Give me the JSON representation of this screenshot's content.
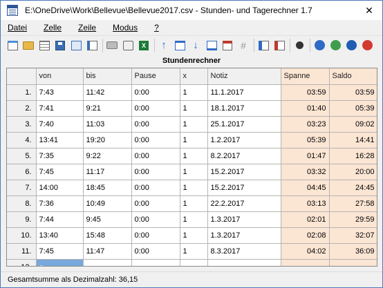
{
  "window": {
    "title": "E:\\OneDrive\\Work\\Bellevue\\Bellevue2017.csv - Stunden- und Tagerechner 1.7",
    "close_glyph": "✕"
  },
  "menu": [
    {
      "label": "Datei"
    },
    {
      "label": "Zelle"
    },
    {
      "label": "Zeile"
    },
    {
      "label": "Modus"
    },
    {
      "label": "?"
    }
  ],
  "toolbar": {
    "icons": [
      "new-icon",
      "open-folder-icon",
      "grid-icon",
      "save-icon",
      "edit-icon",
      "export-icon",
      "print-icon",
      "print-preview-icon",
      "excel-icon",
      "arrow-up-icon",
      "move-up-icon",
      "arrow-down-icon",
      "move-down-icon",
      "calendar-icon",
      "hash-icon",
      "insert-row-icon",
      "delete-row-icon",
      "settings-icon",
      "help-icon",
      "globe-icon",
      "info-icon",
      "exit-icon"
    ]
  },
  "section": {
    "title": "Stundenrechner"
  },
  "table": {
    "headers": [
      "",
      "von",
      "bis",
      "Pause",
      "x",
      "Notiz",
      "Spanne",
      "Saldo"
    ],
    "rows": [
      {
        "n": "1.",
        "von": "7:43",
        "bis": "11:42",
        "pause": "0:00",
        "x": "1",
        "notiz": "11.1.2017",
        "spanne": "03:59",
        "saldo": "03:59"
      },
      {
        "n": "2.",
        "von": "7:41",
        "bis": "9:21",
        "pause": "0:00",
        "x": "1",
        "notiz": "18.1.2017",
        "spanne": "01:40",
        "saldo": "05:39"
      },
      {
        "n": "3.",
        "von": "7:40",
        "bis": "11:03",
        "pause": "0:00",
        "x": "1",
        "notiz": "25.1.2017",
        "spanne": "03:23",
        "saldo": "09:02"
      },
      {
        "n": "4.",
        "von": "13:41",
        "bis": "19:20",
        "pause": "0:00",
        "x": "1",
        "notiz": "1.2.2017",
        "spanne": "05:39",
        "saldo": "14:41"
      },
      {
        "n": "5.",
        "von": "7:35",
        "bis": "9:22",
        "pause": "0:00",
        "x": "1",
        "notiz": "8.2.2017",
        "spanne": "01:47",
        "saldo": "16:28"
      },
      {
        "n": "6.",
        "von": "7:45",
        "bis": "11:17",
        "pause": "0:00",
        "x": "1",
        "notiz": "15.2.2017",
        "spanne": "03:32",
        "saldo": "20:00"
      },
      {
        "n": "7.",
        "von": "14:00",
        "bis": "18:45",
        "pause": "0:00",
        "x": "1",
        "notiz": "15.2.2017",
        "spanne": "04:45",
        "saldo": "24:45"
      },
      {
        "n": "8.",
        "von": "7:36",
        "bis": "10:49",
        "pause": "0:00",
        "x": "1",
        "notiz": "22.2.2017",
        "spanne": "03:13",
        "saldo": "27:58"
      },
      {
        "n": "9.",
        "von": "7:44",
        "bis": "9:45",
        "pause": "0:00",
        "x": "1",
        "notiz": "1.3.2017",
        "spanne": "02:01",
        "saldo": "29:59"
      },
      {
        "n": "10.",
        "von": "13:40",
        "bis": "15:48",
        "pause": "0:00",
        "x": "1",
        "notiz": "1.3.2017",
        "spanne": "02:08",
        "saldo": "32:07"
      },
      {
        "n": "11.",
        "von": "7:45",
        "bis": "11:47",
        "pause": "0:00",
        "x": "1",
        "notiz": "8.3.2017",
        "spanne": "04:02",
        "saldo": "36:09"
      }
    ],
    "new_row": {
      "marker": "▸▸",
      "n": "12.",
      "von_partial": "g"
    }
  },
  "status": {
    "text": "Gesamtsumme als Dezimalzahl: 36,15"
  },
  "colors": {
    "accent": "#2b5797",
    "computed_bg": "#fbe5d3",
    "selection": "#78a8dc"
  }
}
